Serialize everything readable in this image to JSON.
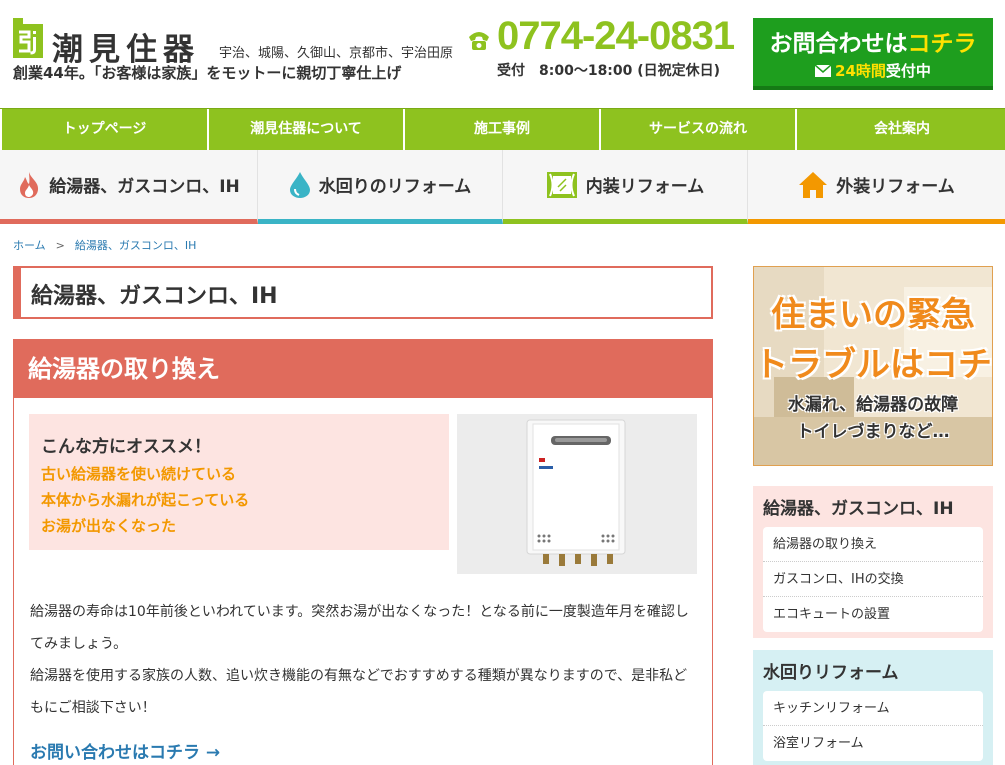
{
  "header": {
    "logo_name": "潮見住器",
    "areas": "宇治、城陽、久御山、京都市、宇治田原",
    "motto": "創業44年。「お客様は家族」をモットーに親切丁寧仕上げ",
    "phone": "0774-24-0831",
    "hours": "受付　8:00〜18:00 (日祝定休日)",
    "contact": {
      "line1_a": "お問合わせは",
      "line1_b": "コチラ",
      "line2_a": "24時間",
      "line2_b": "受付中"
    },
    "colors": {
      "brand_green": "#8ec21f",
      "contact_green": "#1e9e1e",
      "accent_yellow": "#ffe100"
    }
  },
  "topnav": {
    "items": [
      {
        "label": "トップページ"
      },
      {
        "label": "潮見住器について"
      },
      {
        "label": "施工事例"
      },
      {
        "label": "サービスの流れ"
      },
      {
        "label": "会社案内"
      }
    ]
  },
  "catnav": {
    "items": [
      {
        "label": "給湯器、ガスコンロ、IH",
        "icon": "flame-icon",
        "color": "#e06b5c"
      },
      {
        "label": "水回りのリフォーム",
        "icon": "water-drop-icon",
        "color": "#3ab4c6"
      },
      {
        "label": "内装リフォーム",
        "icon": "window-curtain-icon",
        "color": "#8ec21f"
      },
      {
        "label": "外装リフォーム",
        "icon": "house-icon",
        "color": "#f39800"
      }
    ]
  },
  "breadcrumb": {
    "home": "ホーム",
    "separator": ">",
    "current": "給湯器、ガスコンロ、IH"
  },
  "main": {
    "page_title": "給湯器、ガスコンロ、IH",
    "section_title": "給湯器の取り換え",
    "recommend": {
      "title": "こんな方にオススメ！",
      "items": [
        "古い給湯器を使い続けている",
        "本体から水漏れが起こっている",
        "お湯が出なくなった"
      ]
    },
    "product_image": "water-heater-image",
    "paragraph1": "給湯器の寿命は10年前後といわれています。突然お湯が出なくなった！となる前に一度製造年月を確認してみましょう。",
    "paragraph2": "給湯器を使用する家族の人数、追い炊き機能の有無などでおすすめする種類が異なりますので、是非私どもにご相談下さい！",
    "inquiry_link": "お問い合わせはコチラ →"
  },
  "sidebar": {
    "banner": {
      "line1": "住まいの緊急",
      "line2": "トラブルはコチラ",
      "line3": "水漏れ、給湯器の故障",
      "line4": "トイレづまりなど…"
    },
    "box1": {
      "title": "給湯器、ガスコンロ、IH",
      "items": [
        "給湯器の取り換え",
        "ガスコンロ、IHの交換",
        "エコキュートの設置"
      ]
    },
    "box2": {
      "title": "水回りリフォーム",
      "items": [
        "キッチンリフォーム",
        "浴室リフォーム"
      ]
    }
  }
}
